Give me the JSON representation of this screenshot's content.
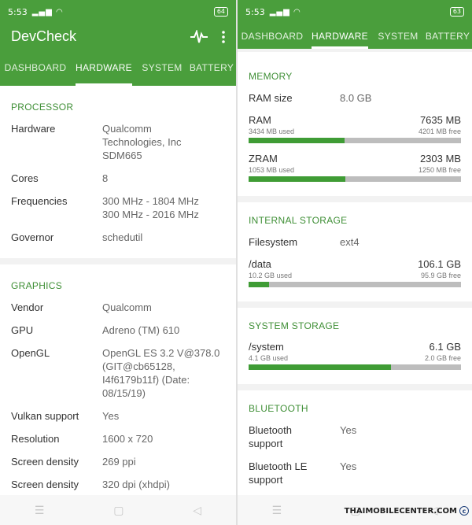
{
  "left": {
    "status": {
      "time": "5:53",
      "battery": "64"
    },
    "app_title": "DevCheck",
    "tabs": [
      "DASHBOARD",
      "HARDWARE",
      "SYSTEM",
      "BATTERY"
    ],
    "processor": {
      "title": "PROCESSOR",
      "rows": [
        {
          "k": "Hardware",
          "v": " Qualcomm\nTechnologies, Inc\nSDM665"
        },
        {
          "k": "Cores",
          "v": "8"
        },
        {
          "k": "Frequencies",
          "v": "300 MHz - 1804 MHz\n300 MHz - 2016 MHz"
        },
        {
          "k": "Governor",
          "v": "schedutil"
        }
      ]
    },
    "graphics": {
      "title": "GRAPHICS",
      "rows": [
        {
          "k": "Vendor",
          "v": "Qualcomm"
        },
        {
          "k": "GPU",
          "v": "Adreno (TM) 610"
        },
        {
          "k": "OpenGL",
          "v": "OpenGL ES 3.2 V@378.0\n(GIT@cb65128,\nI4f6179b11f) (Date:\n08/15/19)"
        },
        {
          "k": "Vulkan support",
          "v": "Yes"
        },
        {
          "k": "Resolution",
          "v": "1600 x 720"
        },
        {
          "k": "Screen density",
          "v": "269 ppi"
        },
        {
          "k": "Screen density",
          "v": "320 dpi (xhdpi)"
        }
      ]
    }
  },
  "right": {
    "status": {
      "time": "5:53",
      "battery": "63"
    },
    "tabs": [
      "DASHBOARD",
      "HARDWARE",
      "SYSTEM",
      "BATTERY"
    ],
    "memory": {
      "title": "MEMORY",
      "ram_size_label": "RAM size",
      "ram_size_value": "8.0 GB",
      "items": [
        {
          "name": "RAM",
          "total": "7635 MB",
          "used": "3434 MB used",
          "free": "4201 MB free",
          "fraction": 0.45
        },
        {
          "name": "ZRAM",
          "total": "2303 MB",
          "used": "1053 MB used",
          "free": "1250 MB free",
          "fraction": 0.457
        }
      ]
    },
    "internal_storage": {
      "title": "INTERNAL STORAGE",
      "fs_label": "Filesystem",
      "fs_value": "ext4",
      "item": {
        "name": "/data",
        "total": "106.1 GB",
        "used": "10.2 GB used",
        "free": "95.9 GB free",
        "fraction": 0.096
      }
    },
    "system_storage": {
      "title": "SYSTEM STORAGE",
      "item": {
        "name": "/system",
        "total": "6.1 GB",
        "used": "4.1 GB used",
        "free": "2.0 GB free",
        "fraction": 0.672
      }
    },
    "bluetooth": {
      "title": "BLUETOOTH",
      "rows": [
        {
          "k": "Bluetooth\nsupport",
          "v": "Yes"
        },
        {
          "k": "Bluetooth LE\nsupport",
          "v": "Yes"
        }
      ]
    }
  },
  "watermark": "THAIMOBILECENTER.COM",
  "colors": {
    "accent": "#4a9e3c",
    "section": "#3f8f36",
    "bar_fill": "#3f9c35",
    "bar_bg": "#bdbdbd"
  }
}
